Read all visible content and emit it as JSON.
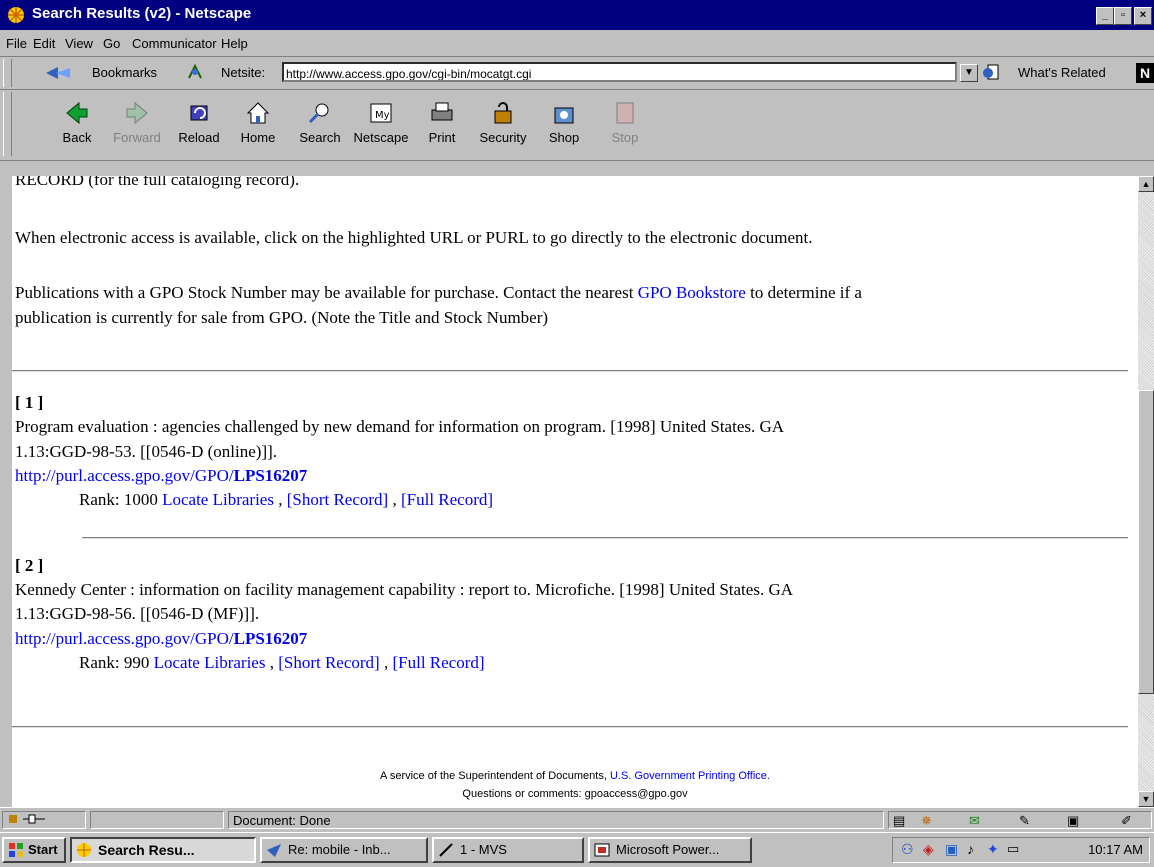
{
  "window": {
    "title": "Search Results (v2) - Netscape"
  },
  "menu": [
    "File",
    "Edit",
    "View",
    "Go",
    "Communicator",
    "Help"
  ],
  "location": {
    "bookmarks_label": "Bookmarks",
    "netsite_label": "Netsite:",
    "url": "http://www.access.gpo.gov/cgi-bin/mocatgt.cgi",
    "whats_related": "What's Related"
  },
  "toolbar": [
    {
      "label": "Back",
      "icon": "back-arrow-icon",
      "enabled": true
    },
    {
      "label": "Forward",
      "icon": "forward-arrow-icon",
      "enabled": false
    },
    {
      "label": "Reload",
      "icon": "reload-icon",
      "enabled": true
    },
    {
      "label": "Home",
      "icon": "home-icon",
      "enabled": true
    },
    {
      "label": "Search",
      "icon": "search-icon",
      "enabled": true
    },
    {
      "label": "Netscape",
      "icon": "netscape-icon",
      "enabled": true
    },
    {
      "label": "Print",
      "icon": "print-icon",
      "enabled": true
    },
    {
      "label": "Security",
      "icon": "lock-icon",
      "enabled": true
    },
    {
      "label": "Shop",
      "icon": "shop-icon",
      "enabled": true
    },
    {
      "label": "Stop",
      "icon": "stop-icon",
      "enabled": false
    }
  ],
  "content": {
    "top_fragment": "RECORD (for the full cataloging record).",
    "electronic_access": "When electronic access is available, click on the highlighted URL or PURL to go directly to the electronic document.",
    "purchase_text_1": "Publications with a GPO Stock Number may be available for purchase. Contact the nearest ",
    "bookstore_link": "GPO Bookstore",
    "purchase_text_2": " to determine if a",
    "purchase_text_3": "publication is currently for sale from GPO. (Note the Title and Stock Number)",
    "results": [
      {
        "num": "[ 1 ]",
        "line1": "Program evaluation : agencies challenged by new demand for information on program. [1998] United States. GA",
        "line2": "1.13:GGD-98-53. [[0546-D (online)]].",
        "url_prefix": "http://purl.access.gpo.gov/GPO/",
        "url_id": "LPS16207",
        "rank": "Rank: 1000",
        "locate": "Locate Libraries",
        "short": "[Short Record]",
        "full": "[Full Record]"
      },
      {
        "num": "[ 2 ]",
        "line1": "Kennedy Center : information on facility management capability : report to. Microfiche. [1998] United States. GA",
        "line2": "1.13:GGD-98-56. [[0546-D (MF)]].",
        "url_prefix": "http://purl.access.gpo.gov/GPO/",
        "url_id": "LPS16207",
        "rank": "Rank: 990",
        "locate": "Locate Libraries",
        "short": "[Short Record]",
        "full": "[Full Record]"
      }
    ],
    "footer_text": "A service of the Superintendent of Documents, ",
    "footer_link": "U.S. Government Printing Office.",
    "footer_line2": "Questions or comments: gpoaccess@gpo.gov"
  },
  "status": {
    "text": "Document: Done"
  },
  "taskbar": {
    "start": "Start",
    "tasks": [
      "Search Resu...",
      "Re: mobile - Inb...",
      "1 - MVS",
      "Microsoft Power..."
    ],
    "clock": "10:17 AM"
  }
}
